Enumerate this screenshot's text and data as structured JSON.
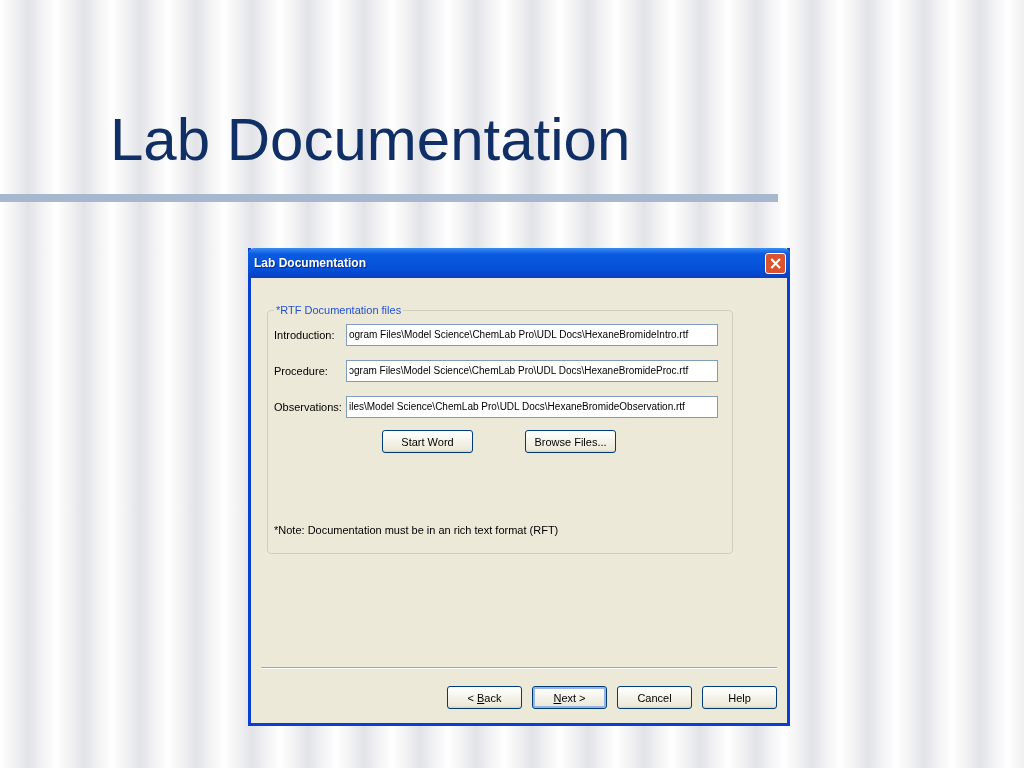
{
  "slide": {
    "title": "Lab Documentation"
  },
  "window": {
    "title": "Lab Documentation",
    "close": "×"
  },
  "group": {
    "legend": "*RTF Documentation files",
    "fields": [
      {
        "label": "Introduction:",
        "value": "ogram Files\\Model Science\\ChemLab Pro\\UDL Docs\\HexaneBromideIntro.rtf"
      },
      {
        "label": "Procedure:",
        "value": "ɔgram Files\\Model Science\\ChemLab Pro\\UDL Docs\\HexaneBromideProc.rtf"
      },
      {
        "label": "Observations:",
        "value": "iles\\Model Science\\ChemLab Pro\\UDL Docs\\HexaneBromideObservation.rtf"
      }
    ],
    "actions": [
      "Start Word",
      "Browse Files..."
    ],
    "note": "*Note: Documentation must be in an rich text format  (RFT)"
  },
  "buttons": [
    {
      "prefix": "< ",
      "key": "B",
      "rest": "ack",
      "default": false
    },
    {
      "key": "N",
      "rest": "ext >",
      "default": true
    },
    {
      "rest": "Cancel",
      "default": false
    },
    {
      "rest": "Help",
      "default": false
    }
  ]
}
